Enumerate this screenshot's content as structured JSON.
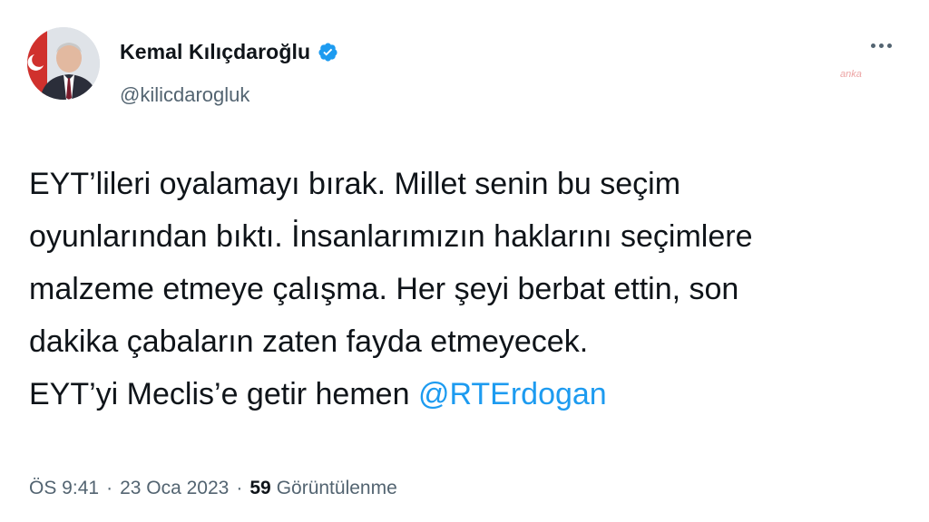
{
  "tweet": {
    "author": {
      "display_name": "Kemal Kılıçdaroğlu",
      "handle": "@kilicdarogluk",
      "verified": true,
      "verified_color": "#1d9bf0"
    },
    "body_lines": [
      "EYT’lileri oyalamayı bırak. Millet senin bu seçim",
      "oyunlarından bıktı. İnsanlarımızın haklarını seçimlere",
      "malzeme etmeye çalışma. Her şeyi berbat ettin, son",
      "dakika çabaların zaten fayda etmeyecek."
    ],
    "last_line_prefix": "EYT’yi Meclis’e getir hemen",
    "mention": "@RTErdogan",
    "mention_color": "#1d9bf0",
    "time": "ÖS 9:41",
    "date": "23 Oca 2023",
    "separator": "·",
    "views_count": "59",
    "views_label": "Görüntülenme"
  },
  "watermark": "anka"
}
